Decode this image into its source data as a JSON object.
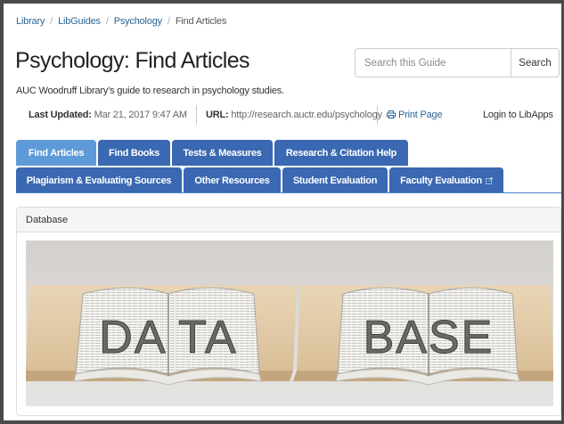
{
  "breadcrumb": {
    "items": [
      "Library",
      "LibGuides",
      "Psychology"
    ],
    "current": "Find Articles",
    "separator": "/"
  },
  "page": {
    "title": "Psychology: Find Articles",
    "description": "AUC Woodruff Library's guide to research in psychology studies."
  },
  "search": {
    "placeholder": "Search this Guide",
    "button_label": "Search"
  },
  "meta": {
    "last_updated_label": "Last Updated:",
    "last_updated_value": "Mar 21, 2017 9:47 AM",
    "url_label": "URL:",
    "url_value": "http://research.auctr.edu/psychology",
    "print_label": "Print Page",
    "login_label": "Login to LibApps"
  },
  "tabs": {
    "row1": [
      "Find Articles",
      "Find Books",
      "Tests & Measures",
      "Research & Citation Help"
    ],
    "row2": [
      "Plagiarism & Evaluating Sources",
      "Other Resources",
      "Student Evaluation",
      "Faculty Evaluation"
    ],
    "active": "Find Articles"
  },
  "panel": {
    "heading": "Database",
    "image_text_left": "DA TA",
    "image_text_right": "BASE"
  },
  "colors": {
    "tab": "#3a68b2",
    "tab_active": "#5f9ad8",
    "link": "#2a6496"
  }
}
